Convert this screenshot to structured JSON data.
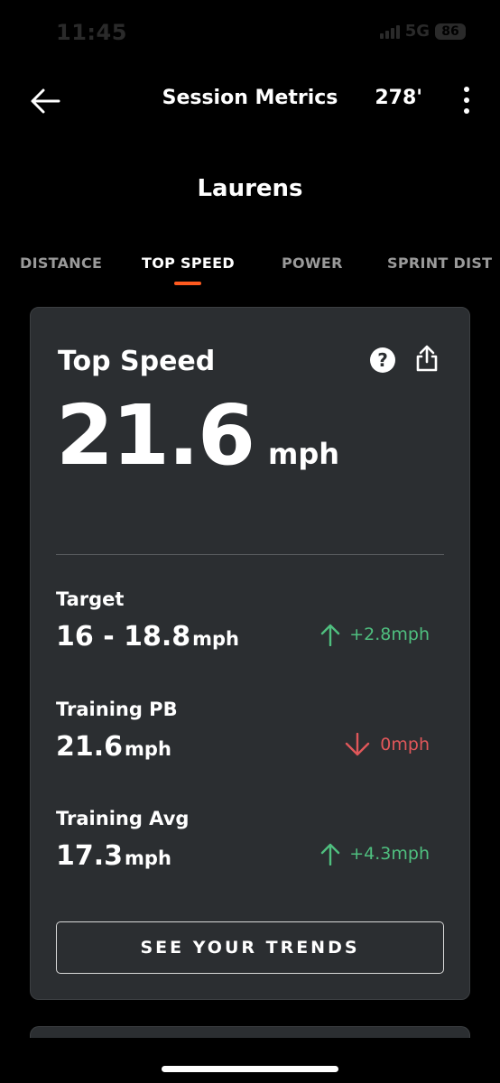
{
  "status_bar": {
    "time": "11:45",
    "network": "5G",
    "battery": "86"
  },
  "header": {
    "title": "Session Metrics",
    "count": "278'"
  },
  "player": {
    "name": "Laurens"
  },
  "tabs": [
    {
      "label": "DISTANCE",
      "active": false
    },
    {
      "label": "TOP SPEED",
      "active": true
    },
    {
      "label": "POWER",
      "active": false
    },
    {
      "label": "SPRINT DIST",
      "active": false
    }
  ],
  "card": {
    "title": "Top Speed",
    "value": "21.6",
    "unit": "mph",
    "metrics": [
      {
        "label": "Target",
        "value": "16 - 18.8",
        "unit": "mph",
        "delta": "+2.8mph",
        "direction": "up"
      },
      {
        "label": "Training PB",
        "value": "21.6",
        "unit": "mph",
        "delta": "0mph",
        "direction": "down"
      },
      {
        "label": "Training Avg",
        "value": "17.3",
        "unit": "mph",
        "delta": "+4.3mph",
        "direction": "up"
      }
    ],
    "trends_button": "SEE YOUR TRENDS"
  },
  "colors": {
    "accent": "#ff5a1f",
    "up": "#4fbf7f",
    "down": "#e0575a",
    "card_bg": "#2b2e31"
  },
  "icons": {
    "back": "arrow-left-icon",
    "more": "more-vertical-icon",
    "help": "help-icon",
    "share": "share-icon",
    "up": "arrow-up-icon",
    "down": "arrow-down-icon"
  }
}
